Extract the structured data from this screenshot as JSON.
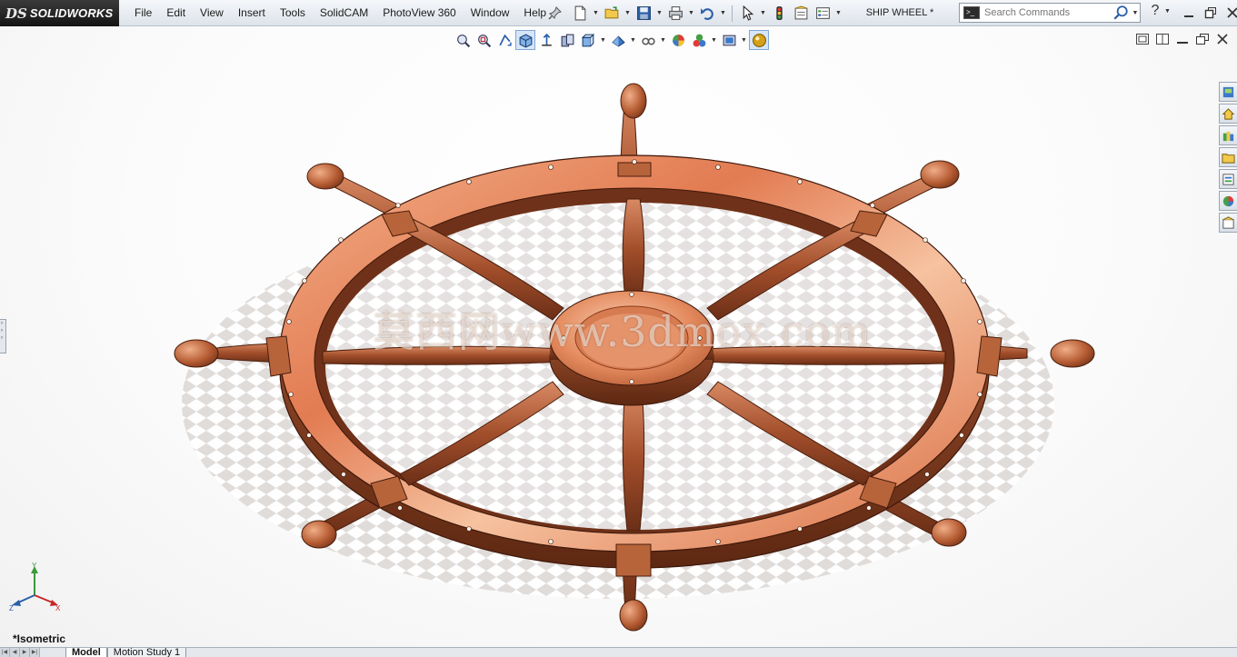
{
  "app": {
    "logo_prefix": "DS",
    "logo_name": "SOLIDWORKS"
  },
  "menu": {
    "items": [
      "File",
      "Edit",
      "View",
      "Insert",
      "Tools",
      "SolidCAM",
      "PhotoView 360",
      "Window",
      "Help"
    ]
  },
  "document": {
    "title": "SHIP WHEEL *"
  },
  "search": {
    "placeholder": "Search Commands"
  },
  "help": {
    "label": "?"
  },
  "viewport": {
    "view_name": "*Isometric",
    "watermark": "莫西网www.3dmox.com",
    "triad": {
      "x_label": "X",
      "y_label": "Y",
      "z_label": "Z"
    }
  },
  "tabs": {
    "items": [
      {
        "label": "Model",
        "active": true
      },
      {
        "label": "Motion Study 1",
        "active": false
      }
    ]
  },
  "colors": {
    "accent": "#3b78c9",
    "wood_light": "#e9906a",
    "wood_dark": "#7a3a1e",
    "logo_bg": "#1e1e1e"
  },
  "icons": {
    "quick_access": [
      "new-document-icon",
      "open-folder-icon",
      "save-icon",
      "print-icon",
      "undo-icon",
      "select-pointer-icon",
      "rebuild-icon",
      "file-properties-icon",
      "options-icon"
    ],
    "heads_up": [
      "zoom-to-fit-icon",
      "zoom-to-area-icon",
      "previous-view-icon",
      "section-view-icon",
      "view-orientation-icon",
      "display-style-icon",
      "hide-show-items-icon",
      "edit-appearance-icon",
      "apply-scene-icon",
      "view-settings-icon",
      "render-tools-icon"
    ],
    "task_pane": [
      "solidworks-resources-icon",
      "design-library-icon",
      "file-explorer-icon",
      "view-palette-icon",
      "appearances-scenes-icon",
      "custom-properties-icon",
      "home-icon"
    ]
  }
}
